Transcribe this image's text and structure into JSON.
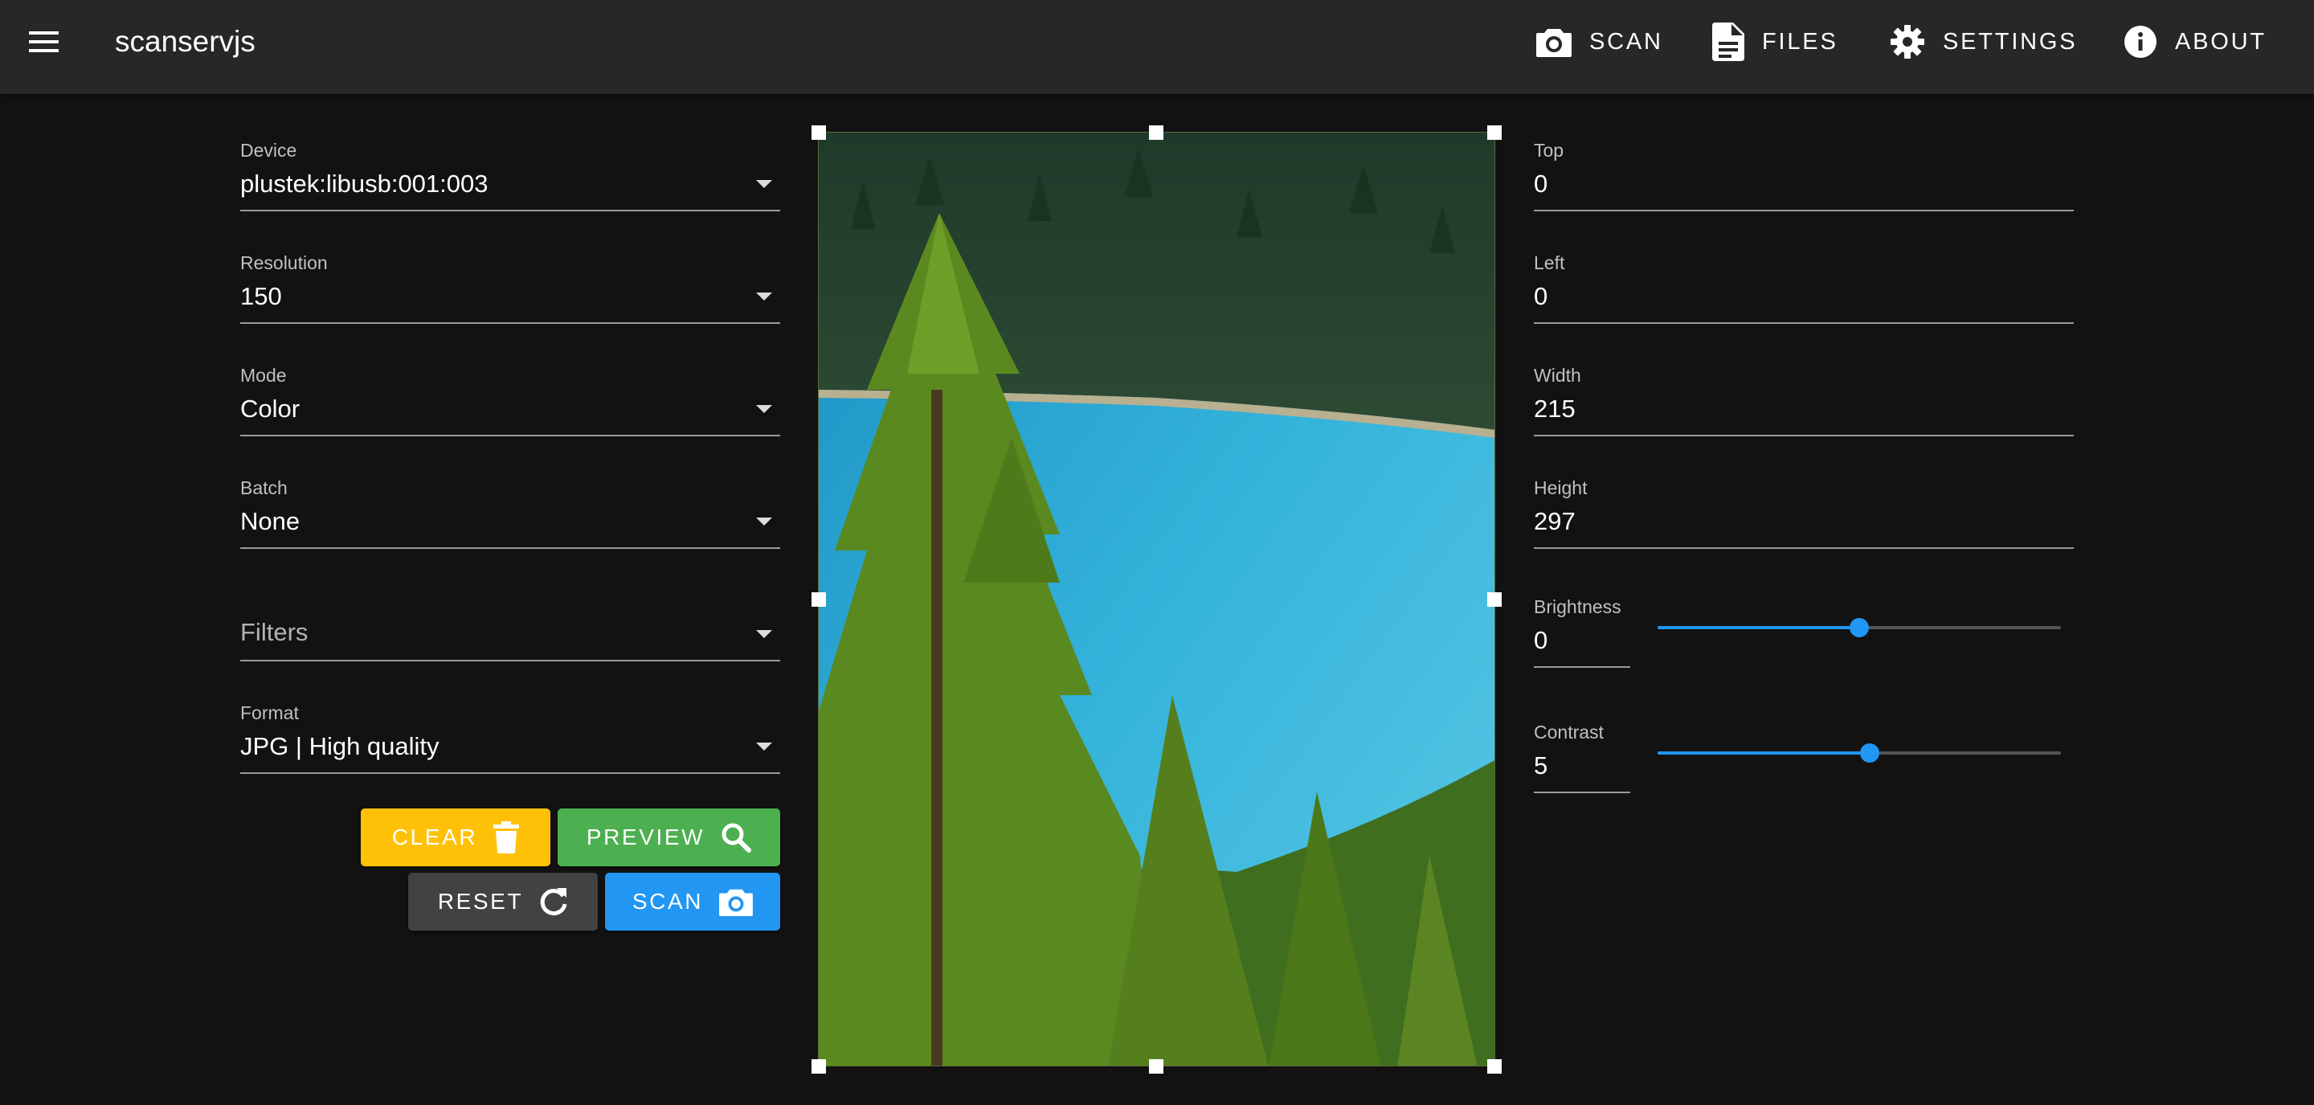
{
  "app": {
    "title": "scanservjs"
  },
  "nav": [
    {
      "label": "Scan",
      "icon": "camera-icon"
    },
    {
      "label": "Files",
      "icon": "file-document-icon"
    },
    {
      "label": "Settings",
      "icon": "gear-icon"
    },
    {
      "label": "About",
      "icon": "info-icon"
    }
  ],
  "left": {
    "device": {
      "label": "Device",
      "value": "plustek:libusb:001:003"
    },
    "resolution": {
      "label": "Resolution",
      "value": "150"
    },
    "mode": {
      "label": "Mode",
      "value": "Color"
    },
    "batch": {
      "label": "Batch",
      "value": "None"
    },
    "filters": {
      "placeholder": "Filters"
    },
    "format": {
      "label": "Format",
      "value": "JPG | High quality"
    }
  },
  "buttons": {
    "clear": "Clear",
    "preview": "Preview",
    "reset": "Reset",
    "scan": "Scan"
  },
  "right": {
    "top": {
      "label": "Top",
      "value": "0"
    },
    "left": {
      "label": "Left",
      "value": "0"
    },
    "width": {
      "label": "Width",
      "value": "215"
    },
    "height": {
      "label": "Height",
      "value": "297"
    },
    "brightness": {
      "label": "Brightness",
      "value": "0",
      "min": -100,
      "max": 100,
      "current": 0
    },
    "contrast": {
      "label": "Contrast",
      "value": "5",
      "min": -100,
      "max": 100,
      "current": 5
    }
  },
  "colors": {
    "appbar": "#272727",
    "background": "#121212",
    "clear": "#ffc107",
    "preview": "#4caf50",
    "reset": "#424242",
    "scan": "#2196f3",
    "slider": "#2196f3"
  }
}
